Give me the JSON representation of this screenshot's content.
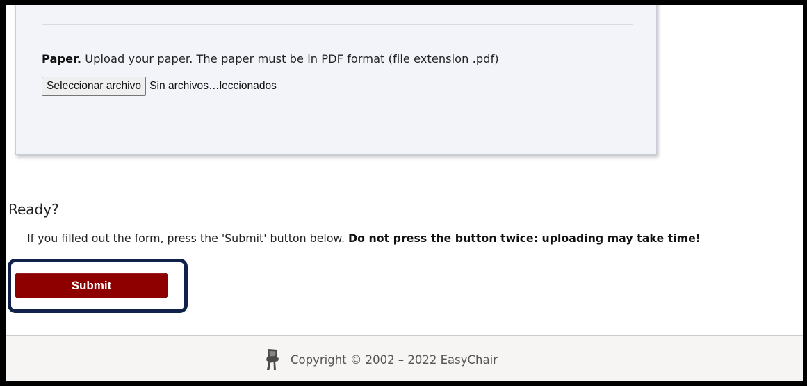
{
  "paper_section": {
    "label": "Paper.",
    "instructions": "Upload your paper. The paper must be in PDF format (file extension .pdf)",
    "file_button_label": "Seleccionar archivo",
    "file_status": "Sin archivos…leccionados"
  },
  "ready_section": {
    "heading": "Ready?",
    "note": "If you filled out the form, press the 'Submit' button below.",
    "warning": "Do not press the button twice: uploading may take time!",
    "submit_label": "Submit"
  },
  "footer": {
    "copyright": "Copyright © 2002 – 2022 EasyChair",
    "logo_icon": "easychair-logo-icon"
  },
  "colors": {
    "submit_button": "#8e0000",
    "highlight_border": "#10214a",
    "panel_background": "#f2f4f9"
  }
}
